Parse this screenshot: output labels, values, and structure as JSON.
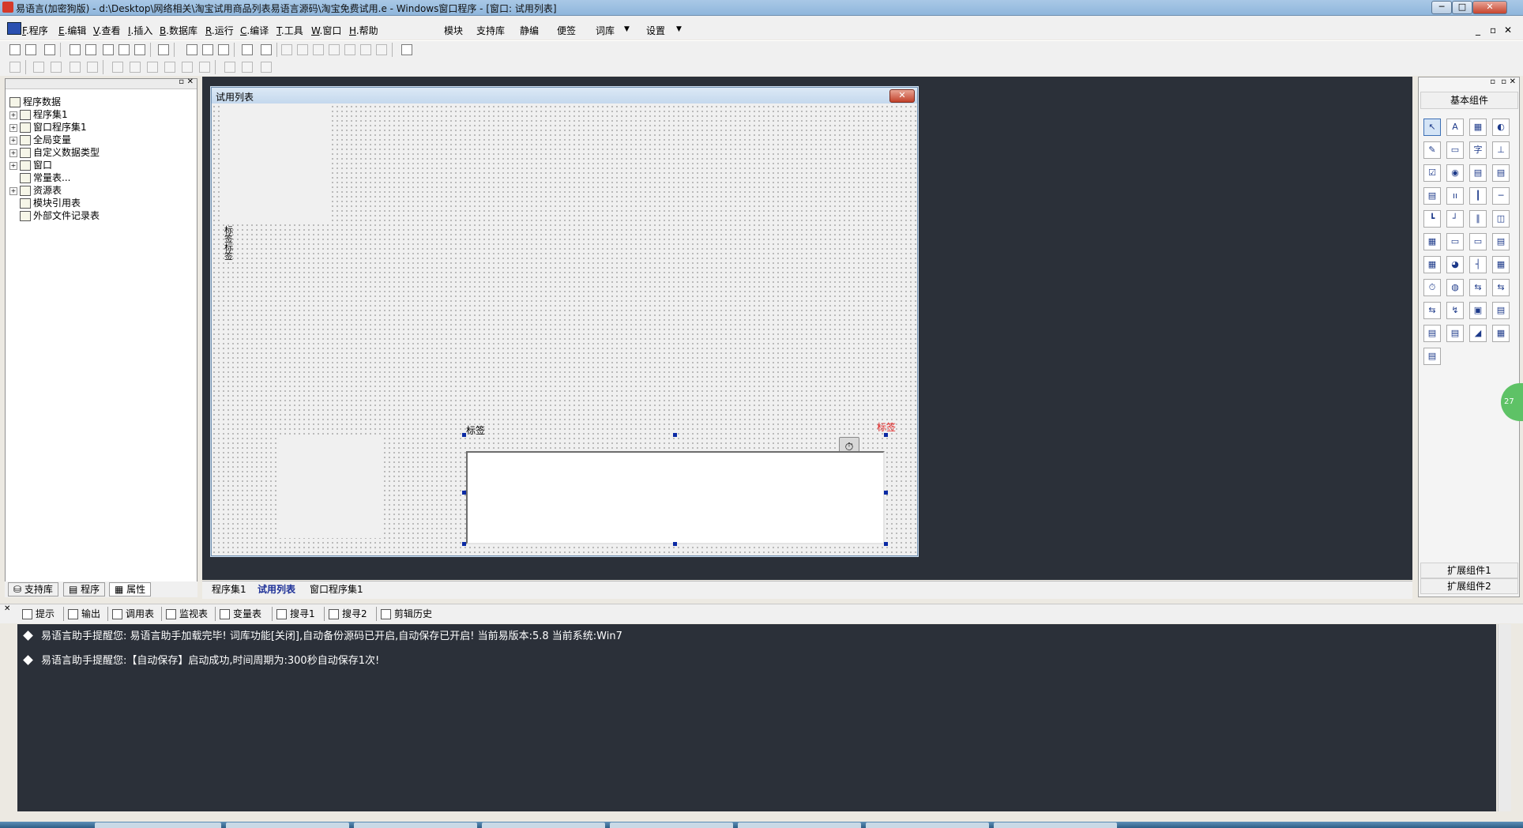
{
  "window": {
    "title": "易语言(加密狗版) - d:\\Desktop\\网络相关\\淘宝试用商品列表易语言源码\\淘宝免费试用.e - Windows窗口程序 - [窗口: 试用列表]",
    "min": "─",
    "max": "□",
    "close": "✕"
  },
  "menu": [
    {
      "key": "F",
      "label": ".程序"
    },
    {
      "key": "E",
      "label": ".编辑"
    },
    {
      "key": "V",
      "label": ".查看"
    },
    {
      "key": "I",
      "label": ".插入"
    },
    {
      "key": "B",
      "label": ".数据库"
    },
    {
      "key": "R",
      "label": ".运行"
    },
    {
      "key": "C",
      "label": ".编译"
    },
    {
      "key": "T",
      "label": ".工具"
    },
    {
      "key": "W",
      "label": ".窗口"
    },
    {
      "key": "H",
      "label": ".帮助"
    }
  ],
  "menu_right": [
    "模块",
    "支持库",
    "静编",
    "便签",
    "词库",
    "设置"
  ],
  "mdi": {
    "min": "_",
    "restore": "▫",
    "close": "✕"
  },
  "tree": {
    "root": "程序数据",
    "items": [
      {
        "label": "程序集1",
        "expander": "+"
      },
      {
        "label": "窗口程序集1",
        "expander": "+"
      },
      {
        "label": "全局变量",
        "expander": "+"
      },
      {
        "label": "自定义数据类型",
        "expander": "+"
      },
      {
        "label": "窗口",
        "expander": "+"
      },
      {
        "label": "常量表...",
        "expander": ""
      },
      {
        "label": "资源表",
        "expander": "+"
      },
      {
        "label": "模块引用表",
        "expander": ""
      },
      {
        "label": "外部文件记录表",
        "expander": ""
      }
    ]
  },
  "left_tabs": [
    "支持库",
    "程序",
    "属性"
  ],
  "form": {
    "title": "试用列表",
    "close": "✕",
    "label_vertical_1": "标签",
    "label_vertical_2": "标签",
    "label_bottom": "标签",
    "label_red": "标签",
    "timer_icon": "⏱"
  },
  "doc_tabs": [
    "程序集1",
    "试用列表",
    "窗口程序集1"
  ],
  "right_panel": {
    "title": "基本组件",
    "ext1": "扩展组件1",
    "ext2": "扩展组件2",
    "bubble": "27"
  },
  "components": [
    "↖",
    "A",
    "▦",
    "◐",
    "✎",
    "▭",
    "字",
    "⊥",
    "☑",
    "◉",
    "▤",
    "▤",
    "▤",
    "ıı",
    "┃",
    "─",
    "┗",
    "┘",
    "∥",
    "◫",
    "▦",
    "▭",
    "▭",
    "▤",
    "▦",
    "◕",
    "┤",
    "▦",
    "⏱",
    "◍",
    "⇆",
    "⇆",
    "⇆",
    "↯",
    "▣",
    "▤",
    "▤",
    "▤",
    "◢",
    "▦",
    "▤"
  ],
  "output_tabs": [
    "提示",
    "输出",
    "调用表",
    "监视表",
    "变量表",
    "搜寻1",
    "搜寻2",
    "剪辑历史"
  ],
  "output_lines": [
    "易语言助手提醒您:  易语言助手加载完毕!  词库功能[关闭],自动备份源码已开启,自动保存已开启!  当前易版本:5.8  当前系统:Win7",
    "易语言助手提醒您:【自动保存】启动成功,时间周期为:300秒自动保存1次!"
  ],
  "colors": {
    "output_bg": "#2b3039",
    "design_bg": "#2b3039",
    "active_tab": "#1c2f97",
    "red_label": "#e02020"
  }
}
